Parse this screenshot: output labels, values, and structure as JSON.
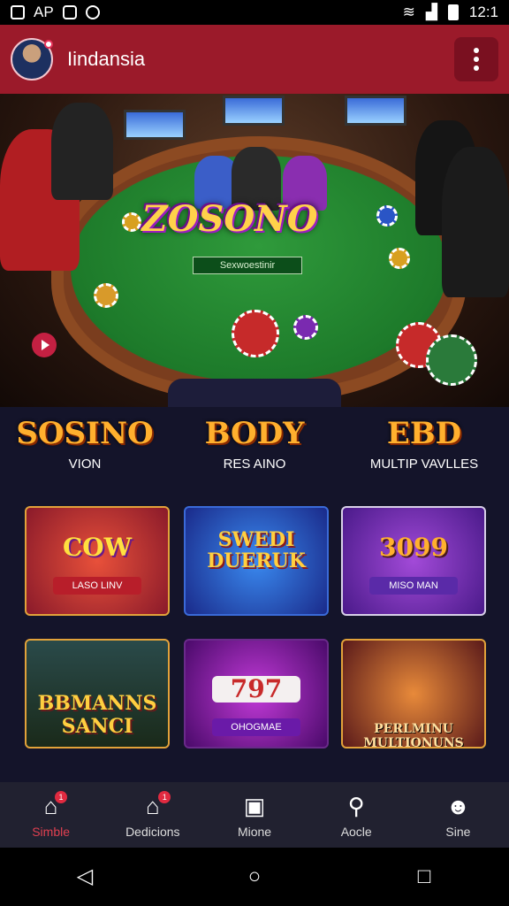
{
  "status": {
    "left_text": "AP",
    "time": "12:1"
  },
  "appbar": {
    "title": "Iindansia"
  },
  "hero": {
    "logo": "ZOSONO",
    "table_label": "Sexwoestinir"
  },
  "categories": [
    {
      "title": "SOSINO",
      "subtitle": "VION"
    },
    {
      "title": "BODY",
      "subtitle": "RES AINO"
    },
    {
      "title": "EBD",
      "subtitle": "MULTIP VAVLLES"
    }
  ],
  "games": [
    {
      "title": "COW",
      "sub": "LASO LINV"
    },
    {
      "title": "SWEDI DUERUK",
      "sub": ""
    },
    {
      "title": "3099",
      "sub": "MISO MAN"
    },
    {
      "title": "BBMANNS SANCI",
      "sub": ""
    },
    {
      "title": "797",
      "sub": "OHOGMAE"
    },
    {
      "title": "PERLMINU MULTIONUNS",
      "sub": ""
    }
  ],
  "nav": [
    {
      "label": "Simble",
      "icon": "home-icon",
      "badge": "1",
      "active": true
    },
    {
      "label": "Dedicions",
      "icon": "home-icon",
      "badge": "1"
    },
    {
      "label": "Mione",
      "icon": "phone-icon",
      "badge": ""
    },
    {
      "label": "Aocle",
      "icon": "search-icon",
      "badge": ""
    },
    {
      "label": "Sine",
      "icon": "user-icon",
      "badge": ""
    }
  ],
  "colors": {
    "accent": "#9b1a2a",
    "active_nav": "#e04050",
    "gold": "#ffb02e"
  }
}
